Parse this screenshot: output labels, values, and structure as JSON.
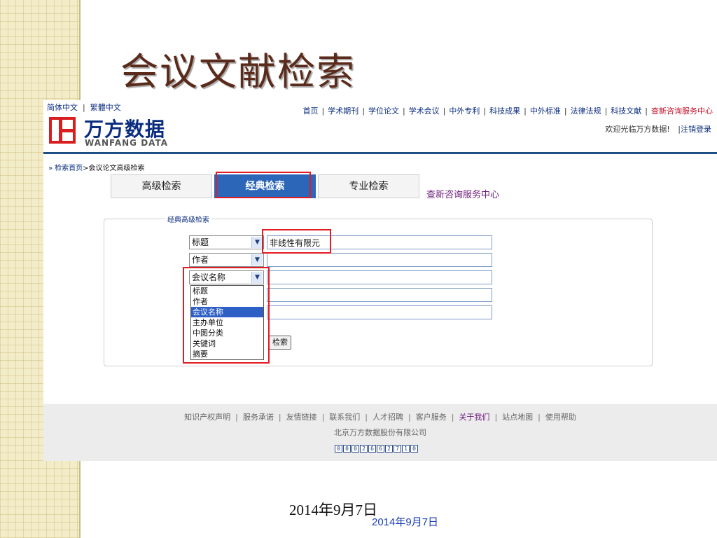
{
  "slide": {
    "title": "会议文献检索",
    "date_main": "2014年9月7日",
    "date_overlay": "2014年9月7日"
  },
  "header": {
    "lang_simplified": "简体中文",
    "lang_traditional": "繁體中文",
    "lang_separator": "|",
    "logo_cn": "万方数据",
    "logo_en": "WANFANG DATA",
    "nav": [
      {
        "label": "首页",
        "highlight": false
      },
      {
        "label": "学术期刊",
        "highlight": false
      },
      {
        "label": "学位论文",
        "highlight": false
      },
      {
        "label": "学术会议",
        "highlight": false
      },
      {
        "label": "中外专利",
        "highlight": false
      },
      {
        "label": "科技成果",
        "highlight": false
      },
      {
        "label": "中外标准",
        "highlight": false
      },
      {
        "label": "法律法规",
        "highlight": false
      },
      {
        "label": "科技文献",
        "highlight": false
      },
      {
        "label": "查新咨询服务中心",
        "highlight": true
      }
    ],
    "nav_separator": "|",
    "welcome": "欢迎光临万方数据!",
    "logout_sep": "|",
    "logout": "注销登录"
  },
  "breadcrumb": {
    "arrow": "»",
    "home": "检索首页",
    "separator": ">",
    "current": "会议论文高级检索"
  },
  "tabs": [
    {
      "label": "高级检索",
      "active": false
    },
    {
      "label": "经典检索",
      "active": true
    },
    {
      "label": "专业检索",
      "active": false
    }
  ],
  "query_center_link": "查新咨询服务中心",
  "form": {
    "legend": "经典高级检索",
    "rows": [
      {
        "field": "标题",
        "value": ""
      },
      {
        "field": "作者",
        "value": ""
      },
      {
        "field": "会议名称",
        "value": ""
      },
      {
        "field": "",
        "value": ""
      },
      {
        "field": "",
        "value": ""
      }
    ],
    "first_value": "非线性有限元",
    "dropdown_options": [
      "标题",
      "作者",
      "会议名称",
      "主办单位",
      "中图分类",
      "关键词",
      "摘要"
    ],
    "dropdown_selected": "会议名称",
    "search_button": "检索",
    "arrow_glyph": "▼"
  },
  "footer": {
    "links": [
      {
        "label": "知识产权声明",
        "active": false
      },
      {
        "label": "服务承诺",
        "active": false
      },
      {
        "label": "友情链接",
        "active": false
      },
      {
        "label": "联系我们",
        "active": false
      },
      {
        "label": "人才招聘",
        "active": false
      },
      {
        "label": "客户服务",
        "active": false
      },
      {
        "label": "关于我们",
        "active": true
      },
      {
        "label": "站点地图",
        "active": false
      },
      {
        "label": "使用帮助",
        "active": false
      }
    ],
    "link_separator": "|",
    "company": "北京万方数据股份有限公司",
    "counter": [
      "0",
      "0",
      "0",
      "2",
      "6",
      "6",
      "2",
      "7",
      "1",
      "0"
    ]
  },
  "colors": {
    "accent": "#2c66b8",
    "highlight": "#e31b23",
    "link": "#0b2d80",
    "title": "#5a2a1a"
  }
}
